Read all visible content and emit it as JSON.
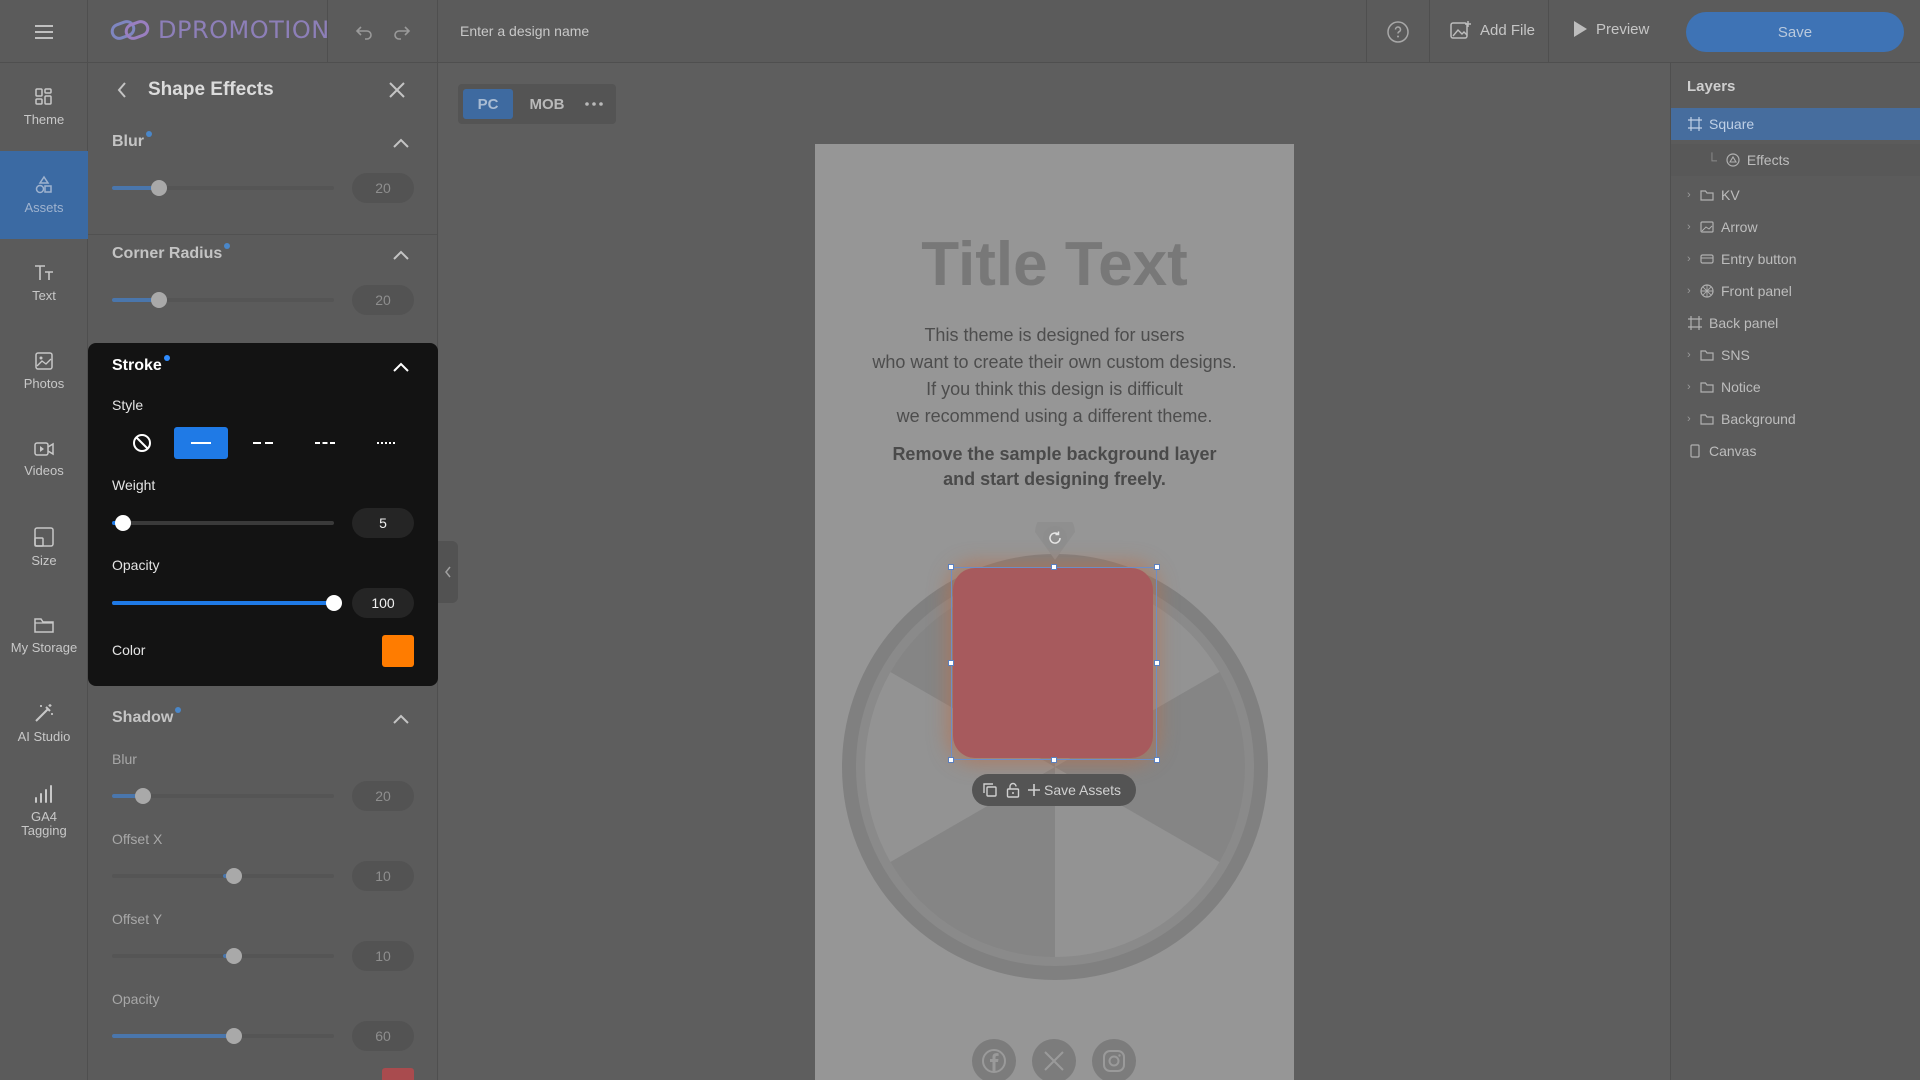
{
  "topbar": {
    "brand": "DPROMOTION",
    "design_name_placeholder": "Enter a design name",
    "add_file_label": "Add File",
    "preview_label": "Preview",
    "save_label": "Save"
  },
  "leftnav": {
    "items": [
      {
        "label": "Theme",
        "icon": "theme-icon"
      },
      {
        "label": "Assets",
        "icon": "assets-icon",
        "active": true
      },
      {
        "label": "Text",
        "icon": "text-icon"
      },
      {
        "label": "Photos",
        "icon": "photos-icon"
      },
      {
        "label": "Videos",
        "icon": "videos-icon"
      },
      {
        "label": "Size",
        "icon": "size-icon"
      },
      {
        "label": "My Storage",
        "icon": "folder-icon"
      },
      {
        "label": "AI Studio",
        "icon": "magic-wand-icon"
      },
      {
        "label_line1": "GA4",
        "label_line2": "Tagging",
        "icon": "bar-chart-icon"
      }
    ]
  },
  "panel": {
    "title": "Shape Effects",
    "blur": {
      "title": "Blur",
      "value": "20",
      "percent": 21
    },
    "corner_radius": {
      "title": "Corner Radius",
      "value": "20",
      "percent": 21
    },
    "stroke": {
      "title": "Stroke",
      "style_label": "Style",
      "styles": [
        "none",
        "solid",
        "dashed",
        "dashed-short",
        "dotted"
      ],
      "selected_style": "solid",
      "weight_label": "Weight",
      "weight_value": "5",
      "weight_percent": 5,
      "opacity_label": "Opacity",
      "opacity_value": "100",
      "opacity_percent": 100,
      "color_label": "Color",
      "color": "#ff7c00"
    },
    "shadow": {
      "title": "Shadow",
      "blur_label": "Blur",
      "blur_value": "20",
      "blur_percent": 14,
      "offset_x_label": "Offset X",
      "offset_x_value": "10",
      "offset_x_percent": 55,
      "offset_y_label": "Offset Y",
      "offset_y_value": "10",
      "offset_y_percent": 55,
      "opacity_label": "Opacity",
      "opacity_value": "60",
      "opacity_percent": 55,
      "color": "#a94b4e"
    }
  },
  "canvas": {
    "device_pc": "PC",
    "device_mob": "MOB",
    "title": "Title Text",
    "body_lines": [
      "This theme is designed for users",
      "who want to create their own custom designs.",
      "If you think this design is difficult",
      "we recommend using a different theme."
    ],
    "bold_lines": [
      "Remove the sample background layer",
      "and start designing freely."
    ],
    "save_assets_label": "Save Assets",
    "shape_color": "#a75a5d"
  },
  "layers": {
    "title": "Layers",
    "items": [
      {
        "label": "Square",
        "icon": "artboard-icon",
        "selected": true
      },
      {
        "label": "Effects",
        "icon": "effects-icon",
        "sub": true
      },
      {
        "label": "KV",
        "icon": "folder-icon",
        "expandable": true
      },
      {
        "label": "Arrow",
        "icon": "image-icon",
        "expandable": true
      },
      {
        "label": "Entry button",
        "icon": "button-icon",
        "expandable": true
      },
      {
        "label": "Front panel",
        "icon": "wheel-icon",
        "expandable": true
      },
      {
        "label": "Back panel",
        "icon": "artboard-icon"
      },
      {
        "label": "SNS",
        "icon": "folder-icon",
        "expandable": true
      },
      {
        "label": "Notice",
        "icon": "folder-icon",
        "expandable": true
      },
      {
        "label": "Background",
        "icon": "folder-icon",
        "expandable": true
      },
      {
        "label": "Canvas",
        "icon": "canvas-icon"
      }
    ]
  }
}
